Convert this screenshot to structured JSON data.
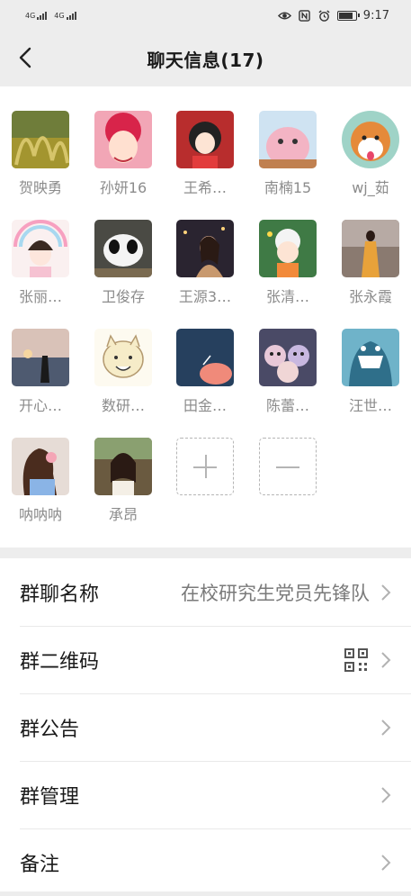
{
  "status_bar": {
    "network_1": "4G",
    "network_2": "4G",
    "time": "9:17",
    "icons": [
      "eye-icon",
      "nfc-icon",
      "alarm-icon",
      "battery-icon"
    ]
  },
  "header": {
    "title": "聊天信息(17)",
    "back_icon": "chevron-left-icon"
  },
  "members": [
    {
      "name": "贺映勇"
    },
    {
      "name": "孙妍16"
    },
    {
      "name": "王希…"
    },
    {
      "name": "南楠15"
    },
    {
      "name": "wj_茹"
    },
    {
      "name": "张丽…"
    },
    {
      "name": "卫俊存"
    },
    {
      "name": "王源3…"
    },
    {
      "name": "张清…"
    },
    {
      "name": "张永霞"
    },
    {
      "name": "开心…"
    },
    {
      "name": "数研…"
    },
    {
      "name": "田金…"
    },
    {
      "name": "陈蕾…"
    },
    {
      "name": "汪世…"
    },
    {
      "name": "呐呐呐"
    },
    {
      "name": "承昂"
    }
  ],
  "member_actions": {
    "add_icon": "plus-icon",
    "remove_icon": "minus-icon"
  },
  "settings": {
    "group_name": {
      "label": "群聊名称",
      "value": "在校研究生党员先锋队"
    },
    "qr_code": {
      "label": "群二维码",
      "icon": "qr-code-icon"
    },
    "announcement": {
      "label": "群公告"
    },
    "management": {
      "label": "群管理"
    },
    "remark": {
      "label": "备注"
    }
  },
  "colors": {
    "page_background": "#ededed",
    "card_background": "#ffffff",
    "secondary_text": "#8c8c8c"
  }
}
